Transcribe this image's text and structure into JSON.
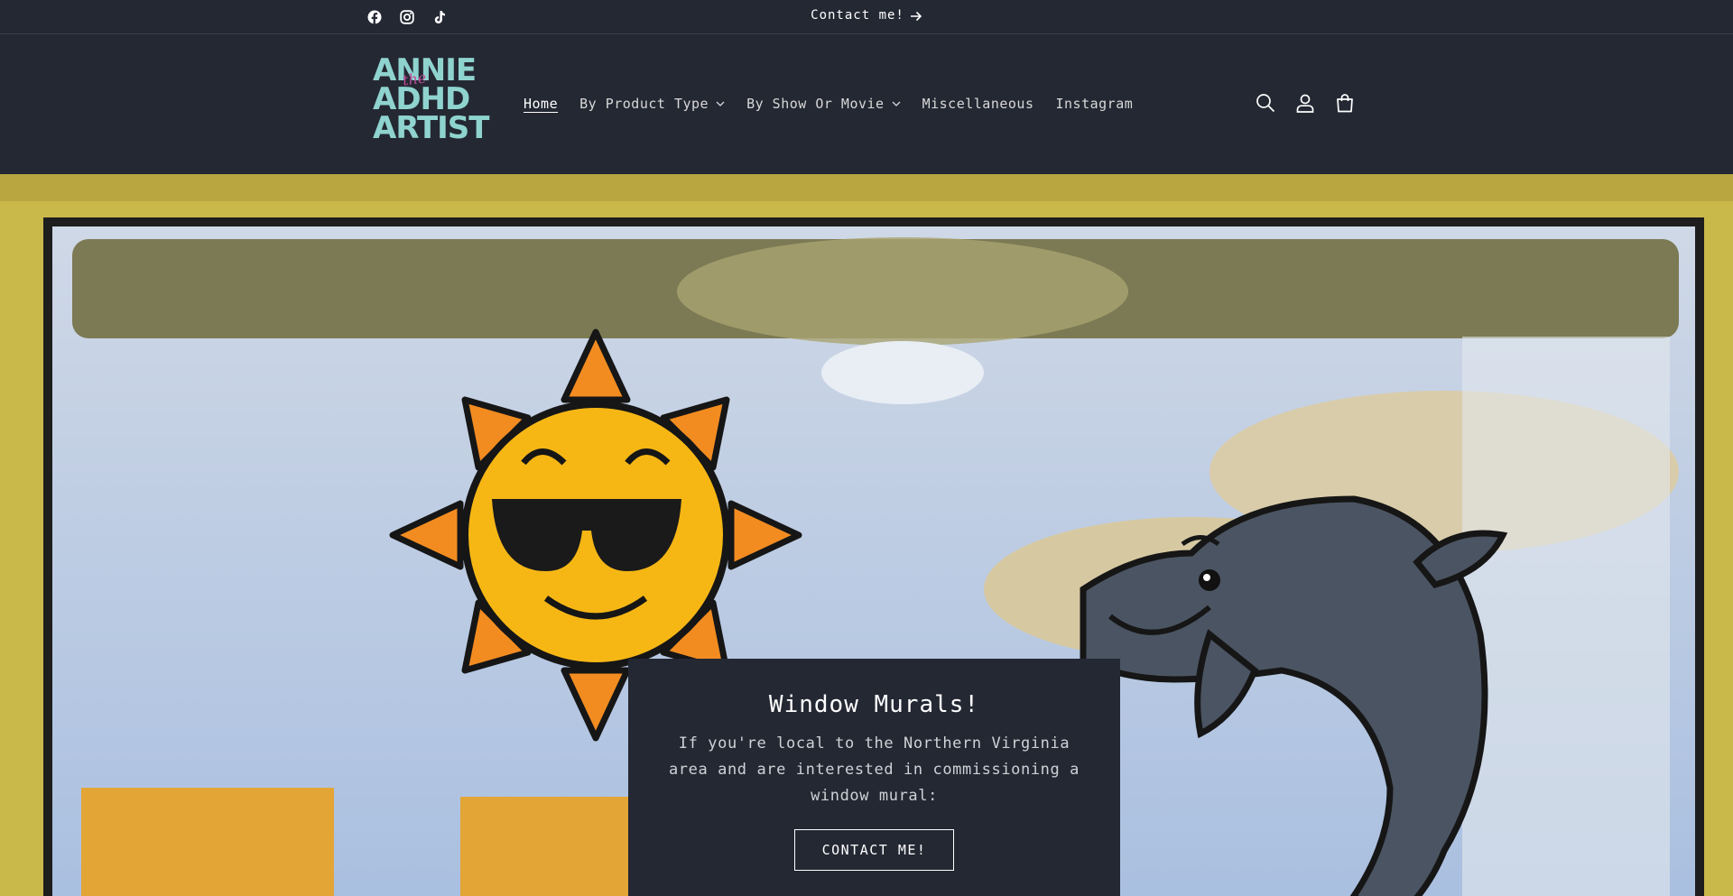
{
  "announcement": {
    "social_icons": [
      "facebook-icon",
      "instagram-icon",
      "tiktok-icon"
    ],
    "link_text": "Contact me!"
  },
  "header": {
    "logo": {
      "line1": "ANNIE",
      "line2": "the",
      "line3": "ADHD",
      "line4": "ARTIST"
    },
    "nav": [
      {
        "label": "Home",
        "active": true,
        "dropdown": false
      },
      {
        "label": "By Product Type",
        "active": false,
        "dropdown": true
      },
      {
        "label": "By Show Or Movie",
        "active": false,
        "dropdown": true
      },
      {
        "label": "Miscellaneous",
        "active": false,
        "dropdown": false
      },
      {
        "label": "Instagram",
        "active": false,
        "dropdown": false
      }
    ],
    "icons": [
      "search-icon",
      "account-icon",
      "cart-icon"
    ]
  },
  "hero": {
    "title": "Window Murals!",
    "text": "If you're local to the Northern Virginia area and are interested in commissioning a window mural:",
    "button_label": "CONTACT ME!"
  },
  "colors": {
    "background": "#242833",
    "logo_teal": "#8fd3cf",
    "logo_pink": "#c34a9c",
    "text": "#ffffff"
  }
}
